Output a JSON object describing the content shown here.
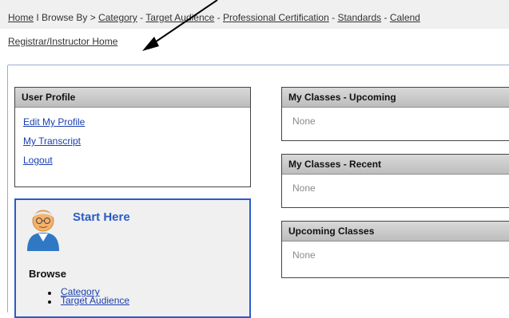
{
  "breadcrumb": {
    "home": "Home",
    "separator": "I",
    "browse_by": "Browse By >",
    "dash": "-",
    "category": "Category",
    "target_audience": "Target Audience",
    "professional_certification": "Professional Certification",
    "standards": "Standards",
    "calendar": "Calend"
  },
  "sub_crumb": "Registrar/Instructor Home",
  "user_profile": {
    "title": "User Profile",
    "links": [
      "Edit My Profile",
      "My Transcript",
      "Logout"
    ]
  },
  "start_here": {
    "title": "Start Here",
    "browse_heading": "Browse",
    "browse_items": [
      "Category",
      "Target Audience"
    ]
  },
  "panels": [
    {
      "title": "My Classes - Upcoming",
      "body": "None"
    },
    {
      "title": "My Classes - Recent",
      "body": "None"
    },
    {
      "title": "Upcoming Classes",
      "body": "None"
    }
  ],
  "colors": {
    "accent": "#2a5cc8",
    "divider": "#9aaecd",
    "annotation_arrow": "#000000"
  }
}
